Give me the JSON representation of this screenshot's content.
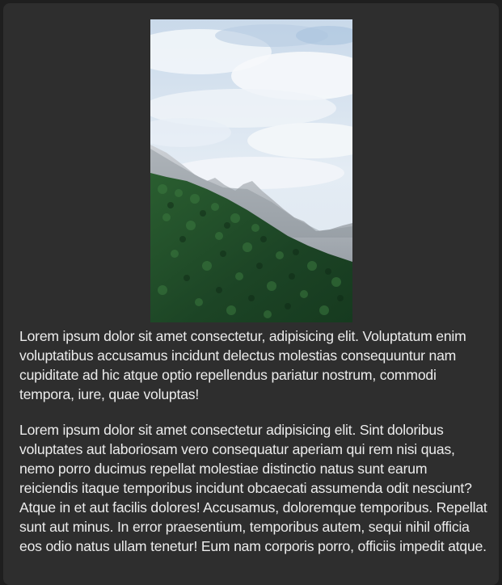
{
  "article": {
    "image": {
      "subject": "mountain-forest-landscape",
      "colors": {
        "sky": "#dfe9f3",
        "cloud": "#f4f7fa",
        "mountain": "#b8bcc3",
        "forest_dark": "#183d22",
        "forest_light": "#2f6a37"
      }
    },
    "paragraphs": [
      "Lorem ipsum dolor sit amet consectetur, adipisicing elit. Voluptatum enim voluptatibus accusamus incidunt delectus molestias consequuntur nam cupiditate ad hic atque optio repellendus pariatur nostrum, commodi tempora, iure, quae voluptas!",
      "Lorem ipsum dolor sit amet consectetur adipisicing elit. Sint doloribus voluptates aut laboriosam vero consequatur aperiam qui rem nisi quas, nemo porro ducimus repellat molestiae distinctio natus sunt earum reiciendis itaque temporibus incidunt obcaecati assumenda odit nesciunt? Atque in et aut facilis dolores! Accusamus, doloremque temporibus. Repellat sunt aut minus. In error praesentium, temporibus autem, sequi nihil officia eos odio natus ullam tenetur! Eum nam corporis porro, officiis impedit atque."
    ]
  }
}
